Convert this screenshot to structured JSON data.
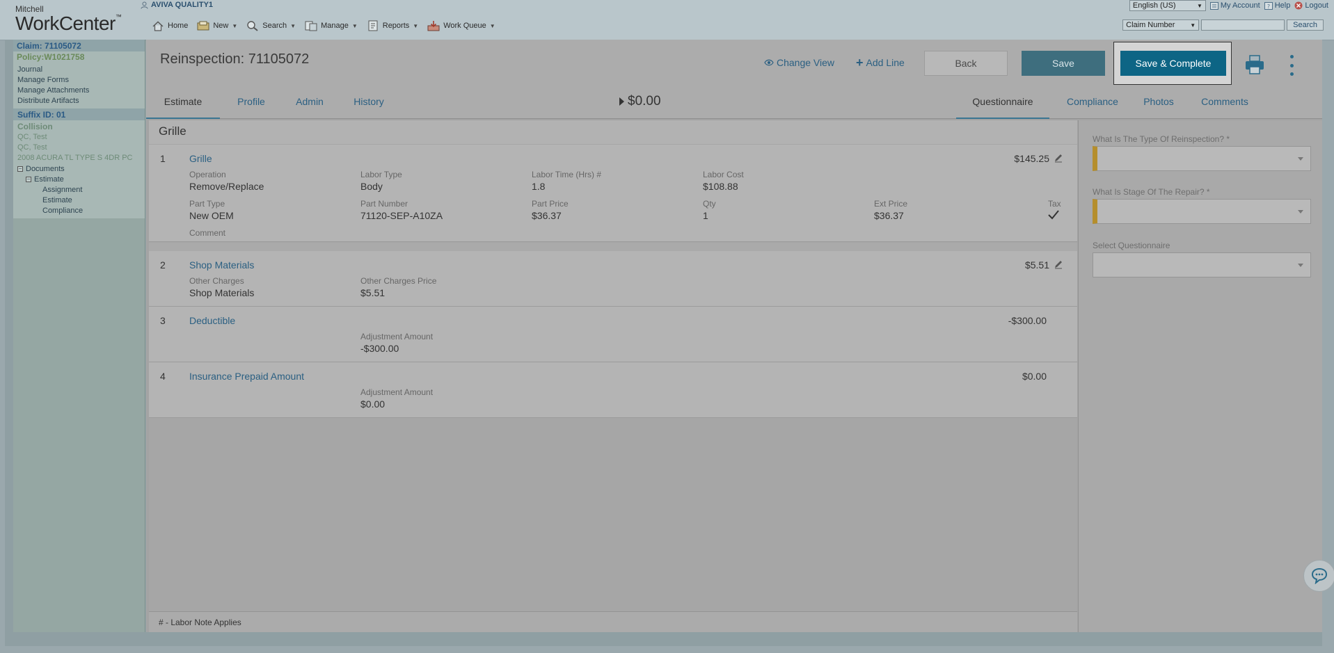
{
  "header": {
    "brand_small": "Mitchell",
    "brand_big": "WorkCenter",
    "brand_tm": "™",
    "user": "AVIVA QUALITY1",
    "nav": [
      {
        "label": "Home",
        "icon": "home-icon"
      },
      {
        "label": "New",
        "icon": "new-icon"
      },
      {
        "label": "Search",
        "icon": "search-icon"
      },
      {
        "label": "Manage",
        "icon": "manage-icon"
      },
      {
        "label": "Reports",
        "icon": "reports-icon"
      },
      {
        "label": "Work Queue",
        "icon": "work-queue-icon"
      }
    ],
    "language": "English (US)",
    "my_account": "My Account",
    "help": "Help",
    "logout": "Logout",
    "search_type": "Claim Number",
    "search_value": "",
    "search_button": "Search"
  },
  "sidebar": {
    "claim": "Claim: 71105072",
    "policy": "Policy:W1021758",
    "links": [
      "Journal",
      "Manage Forms",
      "Manage Attachments",
      "Distribute Artifacts"
    ],
    "suffix": "Suffix ID: 01",
    "coverage": "Collision",
    "people": [
      "QC, Test",
      "QC, Test"
    ],
    "vehicle": "2008 ACURA TL TYPE S 4DR PC",
    "tree": {
      "documents": "Documents",
      "estimate": "Estimate",
      "children": [
        "Assignment",
        "Estimate",
        "Compliance"
      ]
    }
  },
  "page": {
    "title": "Reinspection: 71105072",
    "change_view": "Change View",
    "add_line": "Add Line",
    "back": "Back",
    "save": "Save",
    "save_complete": "Save & Complete",
    "total": "$0.00",
    "tabs_left": [
      "Estimate",
      "Profile",
      "Admin",
      "History"
    ],
    "tabs_right": [
      "Questionnaire",
      "Compliance",
      "Photos",
      "Comments"
    ]
  },
  "estimate": {
    "section": "Grille",
    "lines": [
      {
        "num": "1",
        "title": "Grille",
        "price": "$145.25",
        "operation_label": "Operation",
        "operation": "Remove/Replace",
        "labor_type_label": "Labor Type",
        "labor_type": "Body",
        "labor_time_label": "Labor Time (Hrs) #",
        "labor_time": "1.8",
        "labor_cost_label": "Labor Cost",
        "labor_cost": "$108.88",
        "part_type_label": "Part Type",
        "part_type": "New OEM",
        "part_number_label": "Part Number",
        "part_number": "71120-SEP-A10ZA",
        "part_price_label": "Part Price",
        "part_price": "$36.37",
        "qty_label": "Qty",
        "qty": "1",
        "ext_price_label": "Ext Price",
        "ext_price": "$36.37",
        "tax_label": "Tax",
        "comment_label": "Comment"
      },
      {
        "num": "2",
        "title": "Shop Materials",
        "price": "$5.51",
        "other_charges_label": "Other Charges",
        "other_charges": "Shop Materials",
        "other_price_label": "Other Charges Price",
        "other_price": "$5.51"
      },
      {
        "num": "3",
        "title": "Deductible",
        "price": "-$300.00",
        "adj_label": "Adjustment Amount",
        "adj": "-$300.00"
      },
      {
        "num": "4",
        "title": "Insurance Prepaid Amount",
        "price": "$0.00",
        "adj_label": "Adjustment Amount",
        "adj": "$0.00"
      }
    ],
    "footnote": "# - Labor Note Applies"
  },
  "questionnaire": {
    "q1": "What Is The Type Of Reinspection? *",
    "q2": "What Is Stage Of The Repair? *",
    "q3": "Select Questionnaire"
  }
}
